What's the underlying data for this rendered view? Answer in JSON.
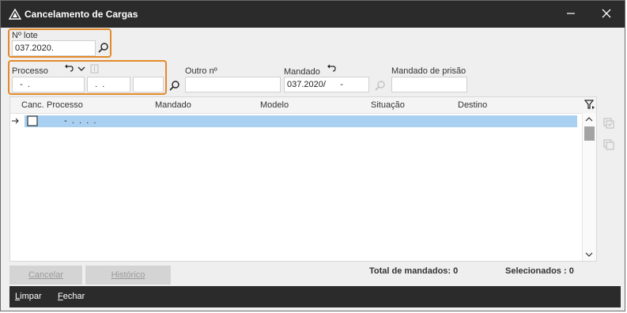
{
  "window": {
    "title": "Cancelamento de Cargas"
  },
  "lote": {
    "label": "Nº lote",
    "value": "037.2020."
  },
  "processo": {
    "label": "Processo",
    "field1": "  -  .",
    "field2": "  .  .",
    "field3": ""
  },
  "outro": {
    "label": "Outro nº",
    "value": ""
  },
  "mandado": {
    "label": "Mandado",
    "value": "037.2020/      -"
  },
  "mandado_prisao": {
    "label": "Mandado de prisão",
    "value": ""
  },
  "grid": {
    "columns": [
      "Canc.",
      "Processo",
      "Mandado",
      "Modelo",
      "Situação",
      "Destino"
    ],
    "rows": [
      {
        "processo": "  -  .  .  .  ."
      }
    ]
  },
  "buttons": {
    "cancelar": "Cancelar",
    "historico": "Histórico"
  },
  "totals": {
    "mandados": "Total de mandados: 0",
    "selecionados": "Selecionados : 0"
  },
  "bottom": {
    "limpar_first": "L",
    "limpar_rest": "impar",
    "fechar_first": "F",
    "fechar_rest": "echar"
  },
  "icons": {
    "logo": "app-logo-icon",
    "minimize": "minimize-icon",
    "close": "close-icon",
    "search": "search-icon",
    "undo": "undo-icon",
    "chevron": "chevron-down-icon",
    "filter": "filter-icon"
  },
  "colors": {
    "titlebar": "#2b2b2b",
    "highlight": "#e38a2a",
    "selection": "#a9d0f1"
  }
}
